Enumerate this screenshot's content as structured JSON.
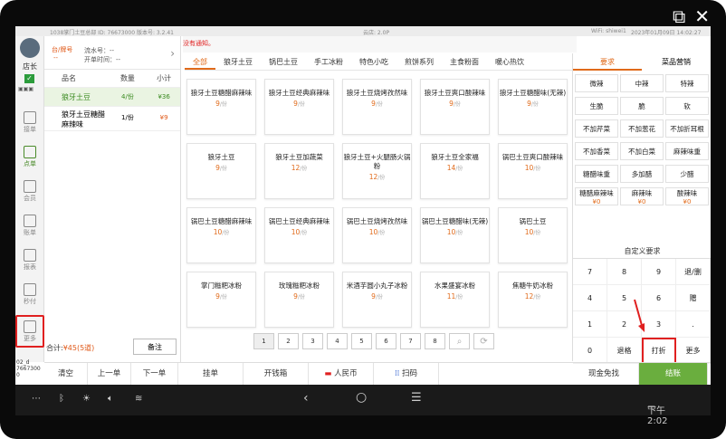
{
  "window": {
    "popout_icon": "popout-icon",
    "close_icon": "close-icon"
  },
  "statusbar": {
    "store": "1038掌门土豆总部 ID: 76673000  版本号: 3.2.41",
    "cloud": "云店: 2.0P",
    "wifi": "WiFi: shiwei1",
    "datetime": "2023年01月09日 14:02:27"
  },
  "rail": {
    "role": "店长",
    "items": [
      {
        "label": "接单",
        "icon": "inbox-icon"
      },
      {
        "label": "点单",
        "icon": "order-icon"
      },
      {
        "label": "会员",
        "icon": "member-icon"
      },
      {
        "label": "账单",
        "icon": "bill-icon"
      },
      {
        "label": "报表",
        "icon": "report-icon"
      },
      {
        "label": "秒付",
        "icon": "quickpay-icon"
      },
      {
        "label": "更多",
        "icon": "more-icon"
      }
    ],
    "version_line1": "02_d",
    "version_line2": "7667300",
    "version_line3": "0"
  },
  "order": {
    "table_label": "台/牌号",
    "table_value": "--",
    "serial_label": "流水号：",
    "serial_value": "--",
    "open_time_label": "开单时间：",
    "open_time_value": "--",
    "col_name": "品名",
    "col_qty": "数量",
    "col_subtotal": "小计",
    "rows": [
      {
        "name": "狼牙土豆",
        "qty": "4/份",
        "subtotal": "¥36"
      },
      {
        "name": "狼牙土豆糖醋麻辣味",
        "qty": "1/份",
        "subtotal": "¥9"
      }
    ],
    "total_label": "合计:",
    "total_value": "¥45(5道)",
    "note_button": "备注"
  },
  "notice": "没有通知。",
  "categories": [
    "全部",
    "狼牙土豆",
    "锅巴土豆",
    "手工冰粉",
    "特色小吃",
    "煎饼系列",
    "主食粉面",
    "暖心热饮"
  ],
  "items": [
    {
      "name": "狼牙土豆糖醋麻辣味",
      "price": "9",
      "unit": "/份"
    },
    {
      "name": "狼牙土豆经典麻辣味",
      "price": "9",
      "unit": "/份"
    },
    {
      "name": "狼牙土豆烧烤孜然味",
      "price": "9",
      "unit": "/份"
    },
    {
      "name": "狼牙土豆爽口酸辣味",
      "price": "9",
      "unit": "/份"
    },
    {
      "name": "狼牙土豆糖醋味(无辣)",
      "price": "9",
      "unit": "/份"
    },
    {
      "name": "狼牙土豆",
      "price": "9",
      "unit": "/份"
    },
    {
      "name": "狼牙土豆加蔬菜",
      "price": "12",
      "unit": "/份"
    },
    {
      "name": "狼牙土豆+火腿肠火锅粉",
      "price": "12",
      "unit": "/份"
    },
    {
      "name": "狼牙土豆全家福",
      "price": "14",
      "unit": "/份"
    },
    {
      "name": "锅巴土豆爽口酸辣味",
      "price": "10",
      "unit": "/份"
    },
    {
      "name": "锅巴土豆糖醋麻辣味",
      "price": "10",
      "unit": "/份"
    },
    {
      "name": "锅巴土豆经典麻辣味",
      "price": "10",
      "unit": "/份"
    },
    {
      "name": "锅巴土豆烧烤孜然味",
      "price": "10",
      "unit": "/份"
    },
    {
      "name": "锅巴土豆糖醋味(无辣)",
      "price": "10",
      "unit": "/份"
    },
    {
      "name": "锅巴土豆",
      "price": "10",
      "unit": "/份"
    },
    {
      "name": "掌门糍粑冰粉",
      "price": "9",
      "unit": "/份"
    },
    {
      "name": "玫瑰糍粑冰粉",
      "price": "9",
      "unit": "/份"
    },
    {
      "name": "米酒芋圆小丸子冰粉",
      "price": "9",
      "unit": "/份"
    },
    {
      "name": "水果盛宴冰粉",
      "price": "11",
      "unit": "/份"
    },
    {
      "name": "焦糖牛奶冰粉",
      "price": "12",
      "unit": "/份"
    }
  ],
  "pager": [
    "1",
    "2",
    "3",
    "4",
    "5",
    "6",
    "7",
    "8"
  ],
  "right": {
    "tab_requirements": "要求",
    "tab_marketing": "菜品营销",
    "requirements": [
      {
        "label": "微辣"
      },
      {
        "label": "中辣"
      },
      {
        "label": "特辣"
      },
      {
        "label": "生脆"
      },
      {
        "label": "脆"
      },
      {
        "label": "软"
      },
      {
        "label": "不加芹菜"
      },
      {
        "label": "不加葱花"
      },
      {
        "label": "不加折耳根"
      },
      {
        "label": "不加香菜"
      },
      {
        "label": "不加白菜"
      },
      {
        "label": "麻辣味重"
      },
      {
        "label": "糖醋味重"
      },
      {
        "label": "多加醋"
      },
      {
        "label": "少醋"
      },
      {
        "label": "糖醋麻辣味",
        "price": "¥0"
      },
      {
        "label": "麻辣味",
        "price": "¥0"
      },
      {
        "label": "酸辣味",
        "price": "¥0"
      }
    ],
    "custom_label": "自定义要求",
    "keys": [
      "7",
      "8",
      "9",
      "退/删",
      "4",
      "5",
      "6",
      "赠",
      "1",
      "2",
      "3",
      ".",
      "0",
      "退格",
      "打折",
      "更多"
    ]
  },
  "bottom": {
    "clear": "清空",
    "prev": "上一单",
    "next": "下一单",
    "hold": "挂单",
    "drawer": "开钱箱",
    "rmb": "人民币",
    "scan": "扫码",
    "cash_free": "现金免找",
    "checkout": "结账"
  },
  "android": {
    "time": "下午2:02"
  }
}
